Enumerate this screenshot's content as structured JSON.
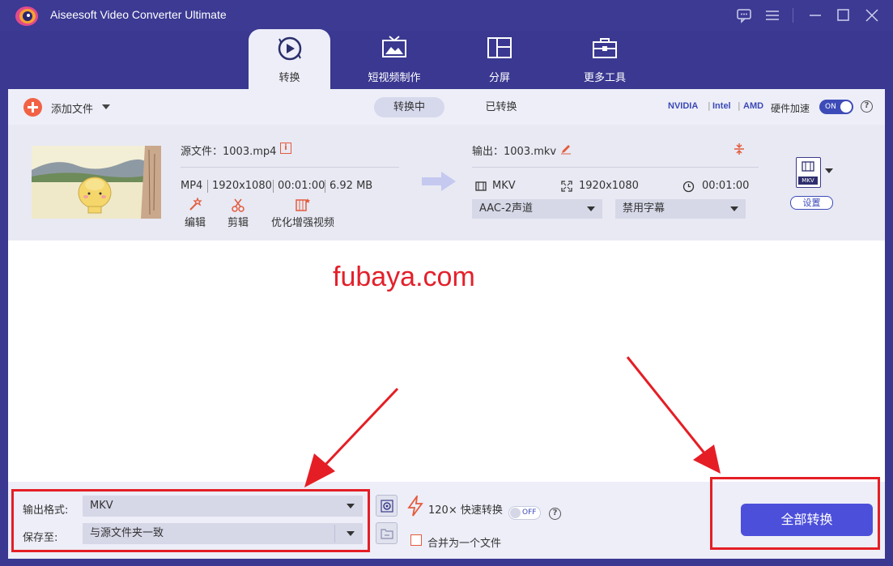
{
  "window": {
    "title": "Aiseesoft Video Converter Ultimate"
  },
  "nav": {
    "tabs": [
      {
        "label": "转换",
        "icon": "convert-icon",
        "active": true
      },
      {
        "label": "短视频制作",
        "icon": "mv-icon",
        "active": false
      },
      {
        "label": "分屏",
        "icon": "collage-icon",
        "active": false
      },
      {
        "label": "更多工具",
        "icon": "toolbox-icon",
        "active": false
      }
    ]
  },
  "toolbar": {
    "add_file_label": "添加文件",
    "tab_converting": "转换中",
    "tab_converted": "已转换",
    "gpu": [
      "NVIDIA",
      "Intel",
      "AMD"
    ],
    "gpu_separator": "|",
    "hw_accel_label": "硬件加速",
    "hw_accel_state": "ON"
  },
  "file": {
    "source_name": "源文件：1003.mp4",
    "format": "MP4",
    "resolution": "1920x1080",
    "duration": "00:01:00",
    "size": "6.92 MB",
    "tools": [
      "编辑",
      "剪辑",
      "优化增强视频"
    ],
    "output_name": "输出：1003.mkv",
    "output_format": "MKV",
    "output_resolution": "1920x1080",
    "output_duration": "00:01:00",
    "audio_track": "AAC-2声道",
    "subtitle": "禁用字幕",
    "format_badge": "MKV",
    "settings_label": "设置"
  },
  "watermark": "fubaya.com",
  "bottom": {
    "output_format_label": "输出格式:",
    "output_format_value": "MKV",
    "save_to_label": "保存至:",
    "save_to_value": "与源文件夹一致",
    "speed_label": "120× 快速转换",
    "speed_state": "OFF",
    "merge_label": "合并为一个文件",
    "convert_all_label": "全部转换"
  },
  "colors": {
    "titlebar": "#3c3a93",
    "accent": "#4c4fda",
    "orange": "#f26144",
    "annotation_red": "#e51e25"
  }
}
